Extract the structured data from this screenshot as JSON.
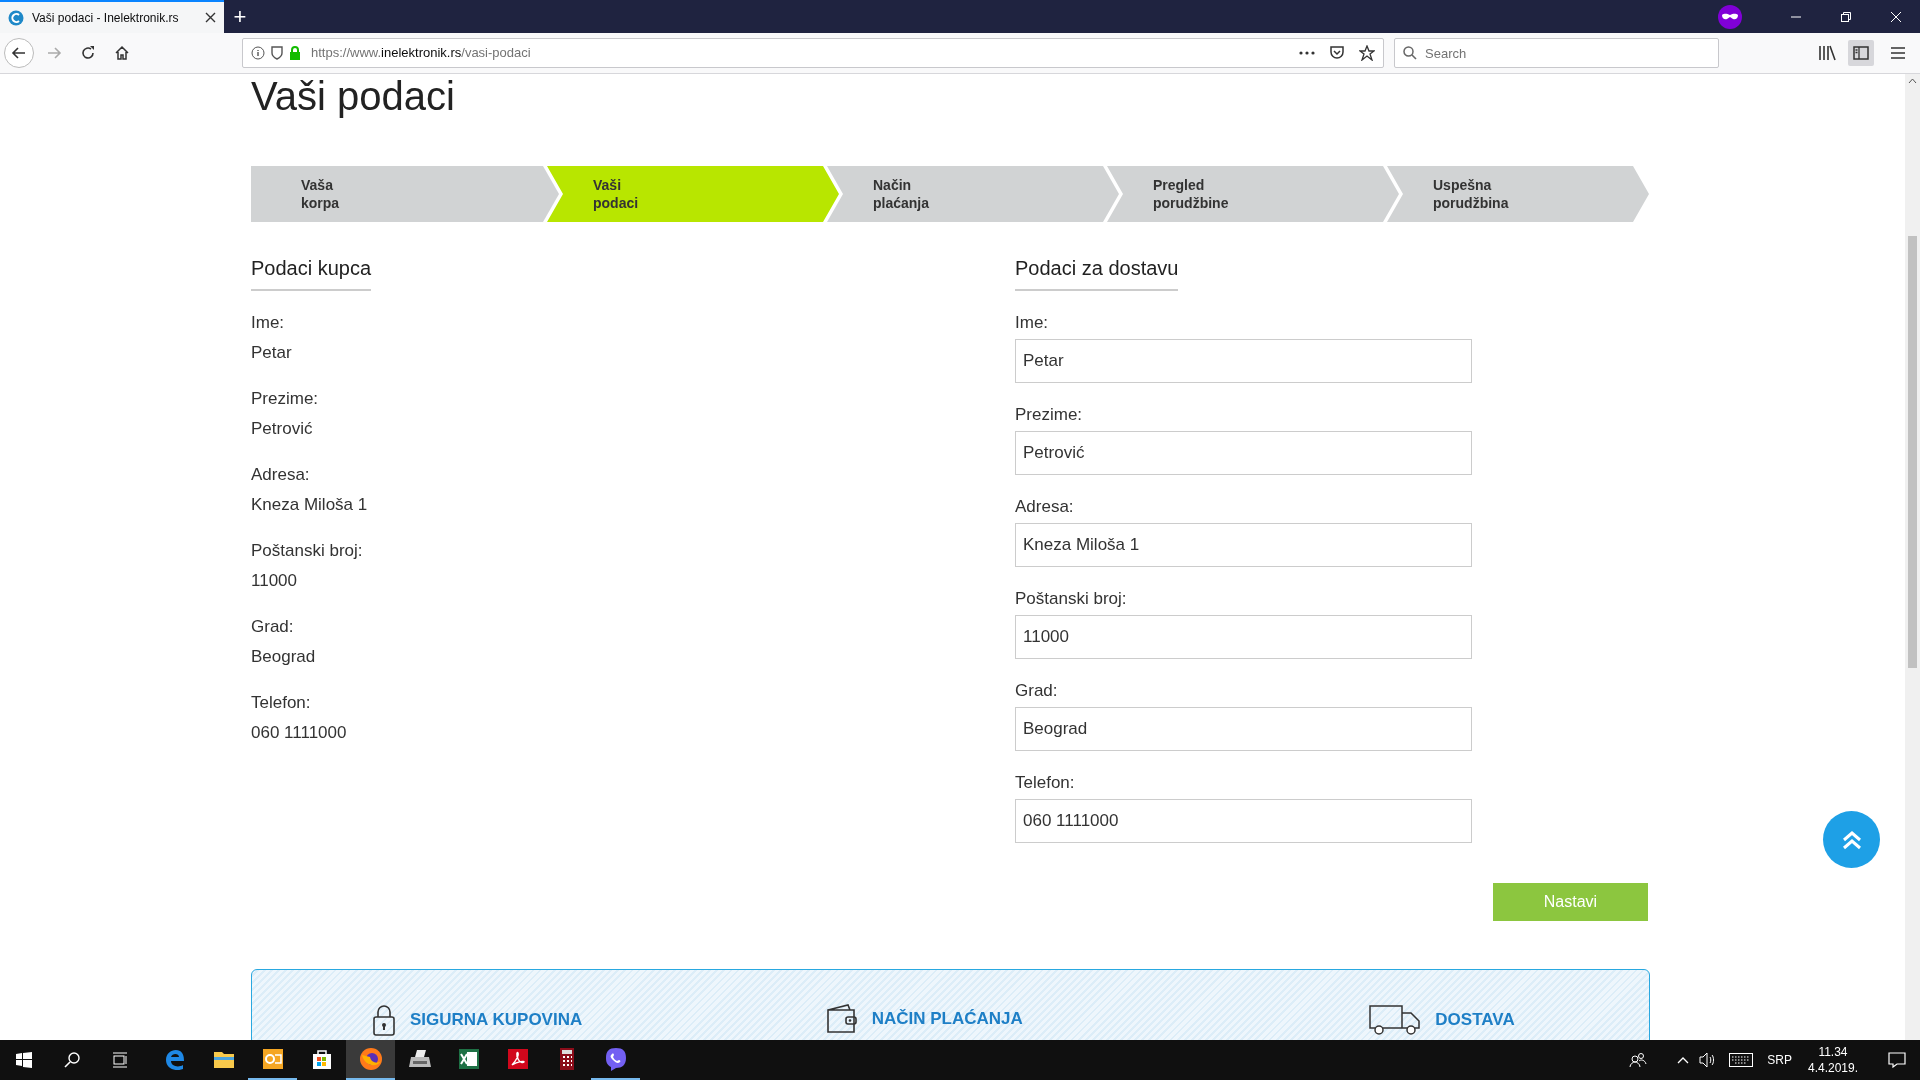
{
  "browser": {
    "tab_title": "Vaši podaci - Inelektronik.rs",
    "new_tab": "+",
    "url_prefix": "https://www.",
    "url_domain": "inelektronik.rs",
    "url_path": "/vasi-podaci",
    "search_placeholder": "Search"
  },
  "page": {
    "title": "Vaši podaci",
    "steps": [
      {
        "label": "Vaša\nkorpa",
        "selected": false
      },
      {
        "label": "Vaši\npodaci",
        "selected": true
      },
      {
        "label": "Način\nplaćanja",
        "selected": false
      },
      {
        "label": "Pregled\nporudžbine",
        "selected": false
      },
      {
        "label": "Uspešna\nporudžbina",
        "selected": false
      }
    ],
    "buyer": {
      "heading": "Podaci kupca",
      "fields": [
        {
          "label": "Ime:",
          "value": "Petar"
        },
        {
          "label": "Prezime:",
          "value": "Petrović"
        },
        {
          "label": "Adresa:",
          "value": "Kneza Miloša 1"
        },
        {
          "label": "Poštanski broj:",
          "value": "11000"
        },
        {
          "label": "Grad:",
          "value": "Beograd"
        },
        {
          "label": "Telefon:",
          "value": "060 1111000"
        }
      ]
    },
    "delivery": {
      "heading": "Podaci za dostavu",
      "fields": [
        {
          "label": "Ime:",
          "value": "Petar"
        },
        {
          "label": "Prezime:",
          "value": "Petrović"
        },
        {
          "label": "Adresa:",
          "value": "Kneza Miloša 1"
        },
        {
          "label": "Poštanski broj:",
          "value": "11000"
        },
        {
          "label": "Grad:",
          "value": "Beograd"
        },
        {
          "label": "Telefon:",
          "value": "060 1111000"
        }
      ]
    },
    "continue_button": "Nastavi",
    "banner": [
      {
        "kind": "lock",
        "label": "SIGURNA KUPOVINA"
      },
      {
        "kind": "wallet",
        "label": "NAČIN PLAĆANJA"
      },
      {
        "kind": "truck",
        "label": "DOSTAVA"
      }
    ]
  },
  "taskbar": {
    "apps": [
      {
        "kind": "edge",
        "running": false,
        "selected": false
      },
      {
        "kind": "explorer",
        "running": false,
        "selected": false
      },
      {
        "kind": "outlook",
        "running": true,
        "selected": false
      },
      {
        "kind": "store",
        "running": false,
        "selected": false
      },
      {
        "kind": "firefox",
        "running": true,
        "selected": true
      },
      {
        "kind": "printer",
        "running": false,
        "selected": false
      },
      {
        "kind": "excel",
        "running": false,
        "selected": false
      },
      {
        "kind": "acrobat",
        "running": false,
        "selected": false
      },
      {
        "kind": "calculator",
        "running": false,
        "selected": false
      },
      {
        "kind": "viber",
        "running": true,
        "selected": false
      }
    ],
    "language": "SRP",
    "time": "11.34",
    "date": "4.4.2019."
  }
}
